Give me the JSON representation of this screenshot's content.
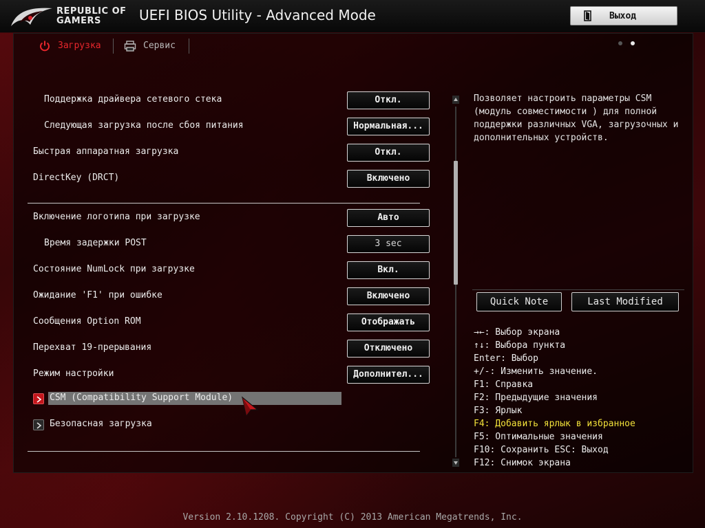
{
  "header": {
    "brand_line1": "REPUBLIC OF",
    "brand_line2": "GAMERS",
    "title": "UEFI BIOS Utility - Advanced Mode",
    "exit_label": "Выход"
  },
  "tabs": [
    {
      "label": "Загрузка",
      "active": true
    },
    {
      "label": "Сервис",
      "active": false
    }
  ],
  "settings": [
    {
      "label": "Поддержка драйвера сетевого стека",
      "value": "Откл."
    },
    {
      "label": "Следующая загрузка после сбоя питания",
      "value": "Нормальная..."
    },
    {
      "label": "Быстрая аппаратная загрузка",
      "value": "Откл."
    },
    {
      "label": "DirectKey (DRCT)",
      "value": "Включено"
    },
    {
      "label": "Включение логотипа при загрузке",
      "value": "Авто"
    },
    {
      "label": "Время задержки POST",
      "value": "3 sec"
    },
    {
      "label": "Состояние NumLock при загрузке",
      "value": "Вкл."
    },
    {
      "label": "Ожидание 'F1' при ошибке",
      "value": "Включено"
    },
    {
      "label": "Сообщения Option ROM",
      "value": "Отображать"
    },
    {
      "label": "Перехват 19-прерывания",
      "value": "Отключено"
    },
    {
      "label": "Режим настройки",
      "value": "Дополнител..."
    }
  ],
  "submenus": [
    {
      "label": "CSM (Compatibility Support Module)",
      "selected": true
    },
    {
      "label": "Безопасная загрузка",
      "selected": false
    }
  ],
  "help_text": "Позволяет настроить параметры CSM (модуль совместимости ) для полной поддержки различных VGA, загрузочных и дополнительных устройств.",
  "side_buttons": {
    "quick_note": "Quick Note",
    "last_modified": "Last Modified"
  },
  "hotkeys": [
    "→←: Выбор экрана",
    "↑↓: Выбора пункта",
    "Enter: Выбор",
    "+/-: Изменить значение.",
    "F1: Справка",
    "F2: Предыдущие значения",
    "F3: Ярлык",
    "F4: Добавить ярлык в избранное",
    "F5: Оптимальные значения",
    "F10: Сохранить ESC: Выход",
    "F12: Снимок экрана"
  ],
  "footer": "Version 2.10.1208. Copyright (C) 2013 American Megatrends, Inc.",
  "colors": {
    "accent_red": "#e8262c",
    "hotkey_highlight": "#f2e23a",
    "selection_bg": "#747474"
  }
}
